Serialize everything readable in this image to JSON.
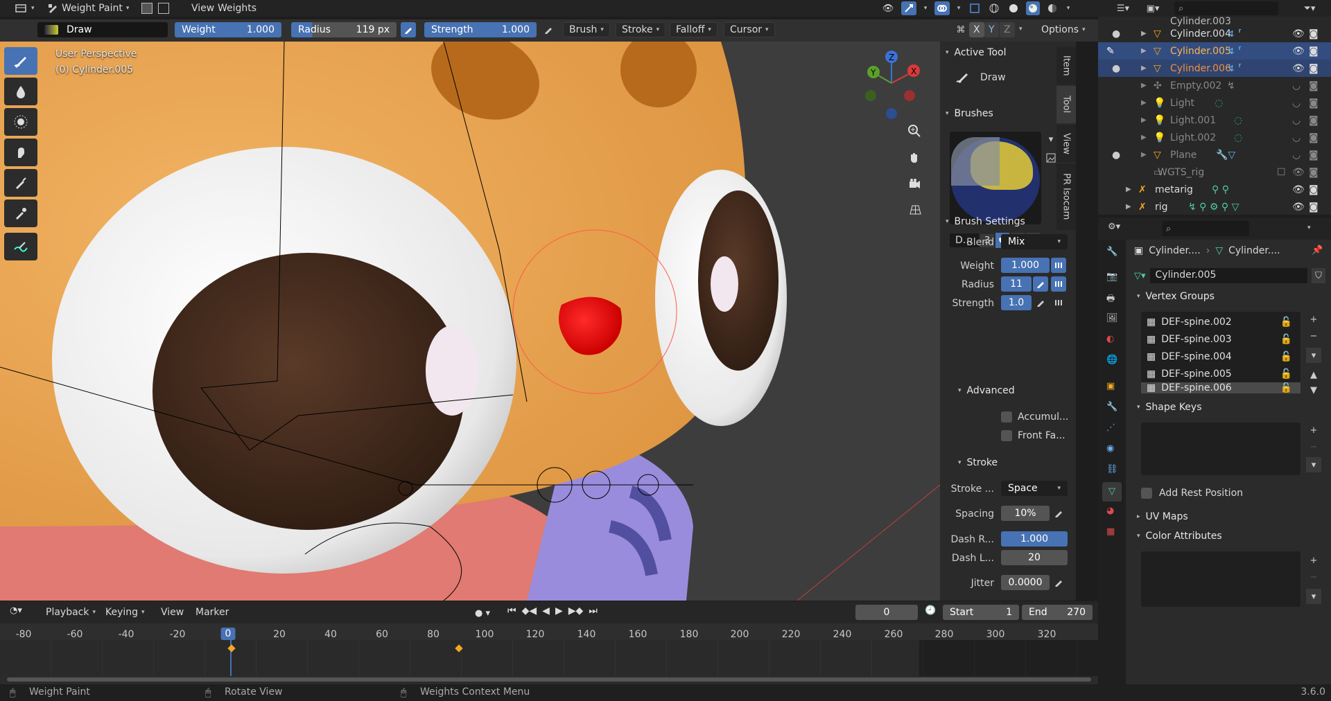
{
  "topbar": {
    "mode_label": "Weight Paint",
    "menus": [
      "View",
      "Weights"
    ]
  },
  "tool_header": {
    "brush_name": "Draw",
    "weight_label": "Weight",
    "weight_value": "1.000",
    "radius_label": "Radius",
    "radius_value": "119 px",
    "strength_label": "Strength",
    "strength_value": "1.000",
    "menus": [
      "Brush",
      "Stroke",
      "Falloff",
      "Cursor"
    ],
    "axis_x": "X",
    "axis_y": "Y",
    "axis_z": "Z",
    "options_label": "Options"
  },
  "viewport": {
    "perspective": "User Perspective",
    "object_label": "(0) Cylinder.005",
    "gizmo": {
      "x": "X",
      "y": "Y",
      "z": "Z"
    }
  },
  "npanel": {
    "tabs": [
      "Item",
      "Tool",
      "View",
      "PR Isocam"
    ],
    "active_tool_title": "Active Tool",
    "active_tool_name": "Draw",
    "brushes_title": "Brushes",
    "brush_short": "D...",
    "brush_users": "3",
    "brush_settings_title": "Brush Settings",
    "blend_label": "Blend",
    "blend_value": "Mix",
    "weight_label": "Weight",
    "weight_value": "1.000",
    "radius_label": "Radius",
    "radius_value": "11",
    "strength_label": "Strength",
    "strength_value": "1.0",
    "advanced_title": "Advanced",
    "accumulate_label": "Accumul...",
    "front_faces_label": "Front Fa...",
    "stroke_title": "Stroke",
    "stroke_method_label": "Stroke ...",
    "stroke_method_value": "Space",
    "spacing_label": "Spacing",
    "spacing_value": "10%",
    "dash_ratio_label": "Dash R...",
    "dash_ratio_value": "1.000",
    "dash_length_label": "Dash L...",
    "dash_length_value": "20",
    "jitter_label": "Jitter",
    "jitter_value": "0.0000"
  },
  "outliner": {
    "rows": [
      {
        "name": "Cylinder.003"
      },
      {
        "name": "Cylinder.004"
      },
      {
        "name": "Cylinder.005"
      },
      {
        "name": "Cylinder.006"
      },
      {
        "name": "Empty.002"
      },
      {
        "name": "Light"
      },
      {
        "name": "Light.001"
      },
      {
        "name": "Light.002"
      },
      {
        "name": "Plane"
      },
      {
        "name": "WGTS_rig"
      },
      {
        "name": "metarig"
      },
      {
        "name": "rig"
      }
    ]
  },
  "properties": {
    "breadcrumb_1": "Cylinder....",
    "breadcrumb_2": "Cylinder....",
    "mesh_name": "Cylinder.005",
    "vertex_groups_title": "Vertex Groups",
    "vertex_groups": [
      "DEF-spine.002",
      "DEF-spine.003",
      "DEF-spine.004",
      "DEF-spine.005",
      "DEF-spine.006"
    ],
    "shape_keys_title": "Shape Keys",
    "add_rest_position_label": "Add Rest Position",
    "uv_maps_title": "UV Maps",
    "color_attributes_title": "Color Attributes"
  },
  "timeline": {
    "menus": [
      "Playback",
      "Keying",
      "View",
      "Marker"
    ],
    "current_frame": "0",
    "start_label": "Start",
    "start_value": "1",
    "end_label": "End",
    "end_value": "270",
    "ticks": [
      "-80",
      "-60",
      "-40",
      "-20",
      "0",
      "20",
      "40",
      "60",
      "80",
      "100",
      "120",
      "140",
      "160",
      "180",
      "200",
      "220",
      "240",
      "260",
      "280",
      "300",
      "320"
    ]
  },
  "status": {
    "items": [
      "Weight Paint",
      "Rotate View",
      "Weights Context Menu"
    ],
    "version": "3.6.0"
  },
  "colors": {
    "accent": "#4772b3",
    "selected_orange": "#f5a623",
    "panel": "#2b2b2b"
  }
}
